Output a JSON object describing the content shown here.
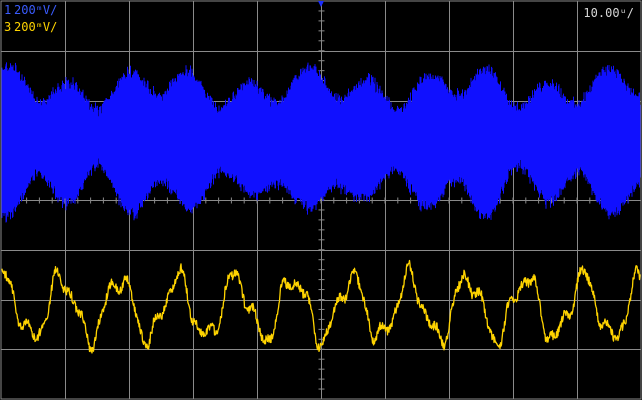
{
  "display": {
    "background_color": "#000000",
    "grid_color": "#8a8a8a",
    "grid": true,
    "divisions": {
      "horizontal": 8,
      "vertical": 10
    },
    "label_color": "#d8d8d8"
  },
  "channels": [
    {
      "number": "1",
      "scale": "200ᵐV/",
      "color": "#1010ff",
      "label_color": "#3a5cff"
    },
    {
      "number": "3",
      "scale": "200ᵐV/",
      "color": "#ffd400",
      "label_color": "#ffd400"
    }
  ],
  "timebase": {
    "scale": "10.00ᵘ/"
  },
  "trigger": {
    "marker_color": "#1a2cff",
    "icon": "trigger-position-marker"
  }
}
